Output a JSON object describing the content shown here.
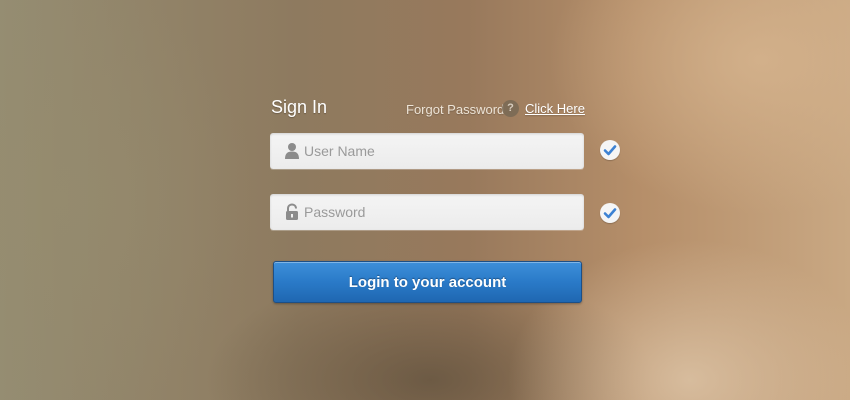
{
  "form": {
    "title": "Sign In",
    "forgot_label": "Forgot Password",
    "help_glyph": "?",
    "click_here": "Click Here",
    "username": {
      "placeholder": "User Name",
      "value": "",
      "icon": "user-icon",
      "valid": true
    },
    "password": {
      "placeholder": "Password",
      "value": "",
      "icon": "lock-icon",
      "valid": true
    },
    "submit_label": "Login to your account"
  },
  "colors": {
    "button_blue": "#2a7ac8",
    "check_blue": "#3d82d3",
    "field_bg": "#f0f0f0"
  }
}
